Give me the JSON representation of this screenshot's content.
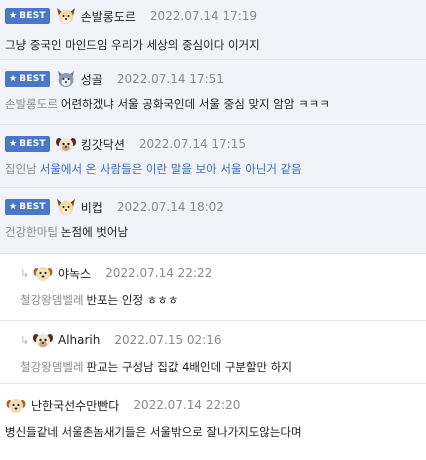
{
  "best_label": "BEST",
  "comments": [
    {
      "type": "best",
      "nick": "손발롱도르",
      "date": "2022.07.14 17:19",
      "avatar_icon": "dog-avatar-icon",
      "mention": "",
      "text": "그냥 중국인 마인드임 우리가 세상의 중심이다 이거지"
    },
    {
      "type": "best",
      "nick": "성골",
      "date": "2022.07.14 17:51",
      "avatar_icon": "husky-avatar-icon",
      "mention": "손발롱도르",
      "text": "어련하겠냐 서울 공화국인데 서울 중심 맞지 암암 ㅋㅋㅋ"
    },
    {
      "type": "best",
      "nick": "킹갓닥션",
      "date": "2022.07.14 17:15",
      "avatar_icon": "pug-avatar-icon",
      "mention": "집인남",
      "text": "서울에서 온 사람들은 이란 말을 보아 서울 아닌거 같음"
    },
    {
      "type": "best",
      "nick": "비컵",
      "date": "2022.07.14 18:02",
      "avatar_icon": "dog-avatar-icon",
      "mention": "건강한마팁",
      "text": "논점에 벗어남"
    },
    {
      "type": "reply",
      "nick": "야녹스",
      "date": "2022.07.14 22:22",
      "avatar_icon": "round-dog-avatar-icon",
      "mention": "철강왕뎀벨레",
      "text": "반포는 인정 ㅎㅎㅎ"
    },
    {
      "type": "reply",
      "nick": "Alharih",
      "date": "2022.07.15 02:16",
      "avatar_icon": "pug-avatar-icon",
      "mention": "철강왕뎀벨레",
      "text": "판교는 구성남 집값 4배인데 구분할만 하지"
    },
    {
      "type": "normal",
      "nick": "난한국선수만빤다",
      "date": "2022.07.14 22:20",
      "avatar_icon": "round-dog-avatar-icon",
      "mention": "",
      "text": "병신들같네 서울촌놈새기들은 서울밖으로 잘나가지도않는다며"
    }
  ],
  "colors": {
    "best_bg": "#f1f3fa",
    "badge": "#4a78c8",
    "mention_text": "#8c8c8c",
    "blue_text": "#3a6bc4"
  }
}
